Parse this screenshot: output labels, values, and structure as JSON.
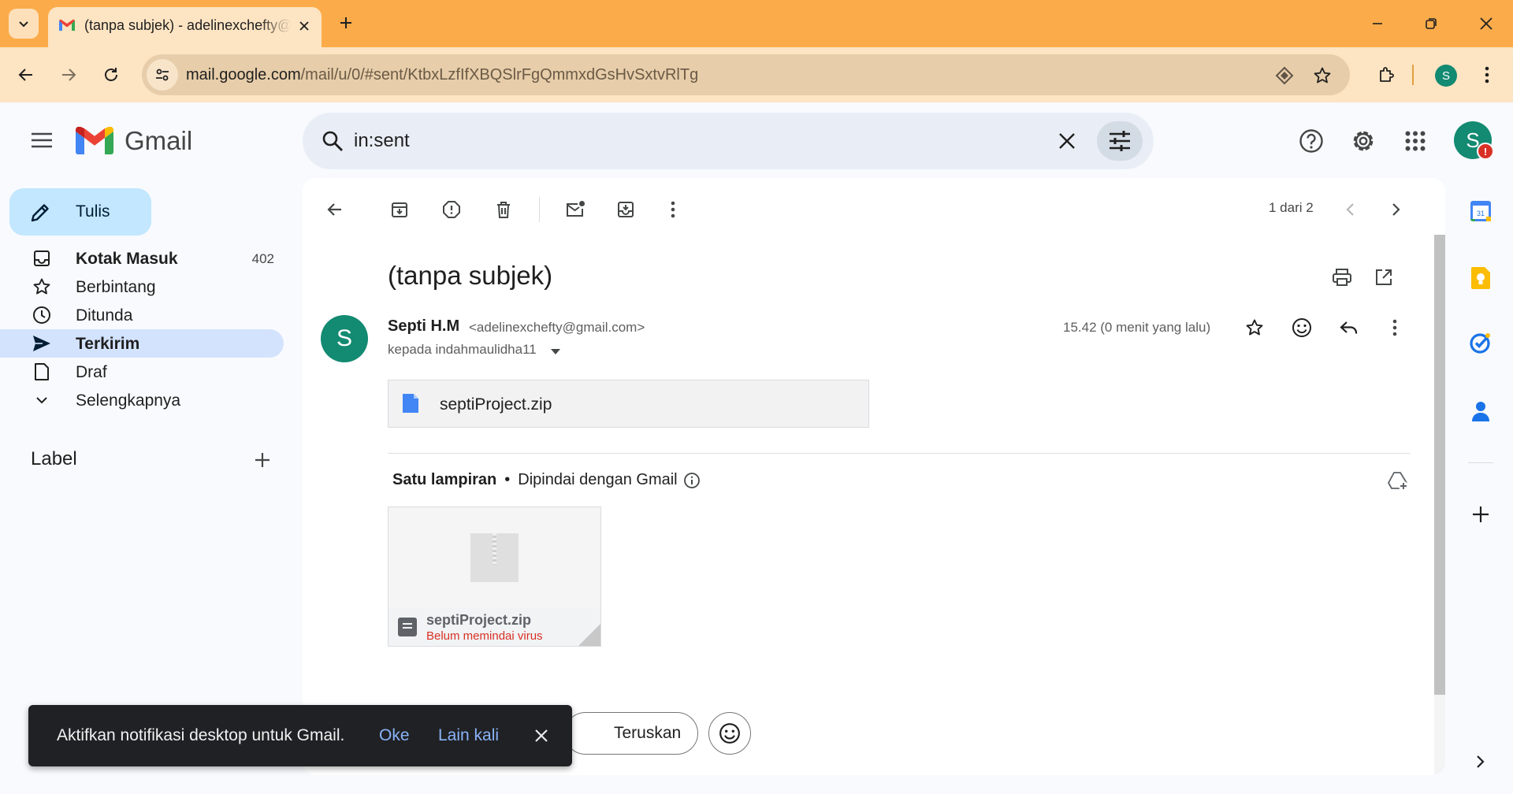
{
  "browser": {
    "tab_title": "(tanpa subjek) - adelinexchefty@gmail.com",
    "url_host": "mail.google.com",
    "url_path": "/mail/u/0/#sent/KtbxLzfIfXBQSlrFgQmmxdGsHvSxtvRlTg",
    "profile_initial": "S",
    "colors": {
      "tab_strip": "#fbab4a",
      "toolbar": "#fde4c2",
      "omnibox": "#e7cda9"
    }
  },
  "gmail": {
    "brand": "Gmail",
    "search": {
      "query": "in:sent"
    },
    "account_initial": "S",
    "account_alert": "!"
  },
  "nav": {
    "compose_label": "Tulis",
    "items": [
      {
        "label": "Kotak Masuk",
        "count": "402",
        "icon": "inbox-icon"
      },
      {
        "label": "Berbintang",
        "count": "",
        "icon": "star-icon"
      },
      {
        "label": "Ditunda",
        "count": "",
        "icon": "clock-icon"
      },
      {
        "label": "Terkirim",
        "count": "",
        "icon": "send-icon"
      },
      {
        "label": "Draf",
        "count": "",
        "icon": "draft-icon"
      },
      {
        "label": "Selengkapnya",
        "count": "",
        "icon": "chevron-down-icon"
      }
    ],
    "label_heading": "Label"
  },
  "message": {
    "pager": "1 dari 2",
    "subject": "(tanpa subjek)",
    "sender_initial": "S",
    "sender_name": "Septi H.M",
    "sender_email": "<adelinexchefty@gmail.com>",
    "recipient": "kepada indahmaulidha11",
    "timestamp": "15.42 (0 menit yang lalu)",
    "attachment_chip": "septiProject.zip",
    "attachment_summary": {
      "count_label": "Satu lampiran",
      "separator": "•",
      "scan_label": "Dipindai dengan Gmail"
    },
    "attachment_card": {
      "name": "septiProject.zip",
      "warning": "Belum memindai virus"
    },
    "forward_label": "Teruskan"
  },
  "snackbar": {
    "message": "Aktifkan notifikasi desktop untuk Gmail.",
    "ok": "Oke",
    "later": "Lain kali"
  },
  "side_apps": [
    "calendar-icon",
    "keep-icon",
    "tasks-icon",
    "contacts-icon",
    "add-icon"
  ]
}
